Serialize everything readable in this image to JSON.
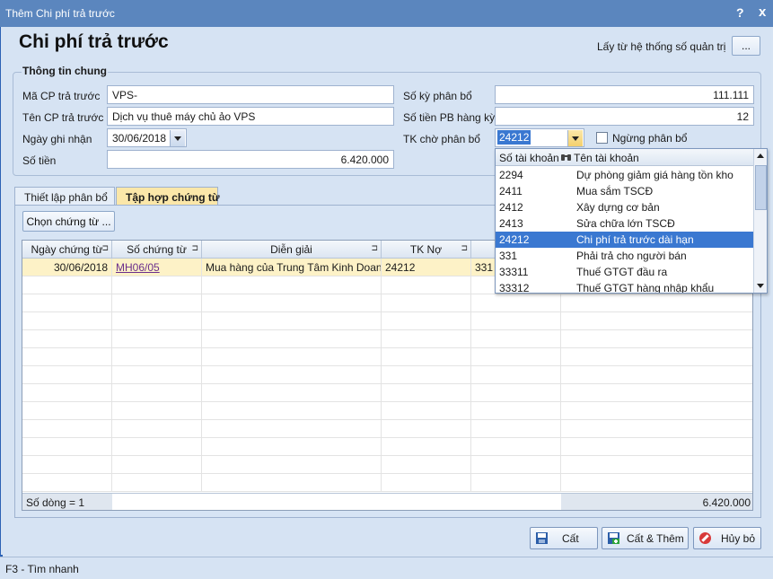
{
  "window": {
    "title": "Thêm Chi phí trả trước",
    "help_icon": "?",
    "close_icon": "x"
  },
  "heading": "Chi phí trả trước",
  "system_settings": {
    "label": "Lấy từ hệ thống số quản trị",
    "button": "..."
  },
  "general": {
    "title": "Thông tin chung",
    "ma_cp_label": "Mã CP trả trước",
    "ma_cp_value": "VPS-",
    "ten_cp_label": "Tên CP trả trước",
    "ten_cp_value": "Dịch vụ thuê máy chủ ảo VPS",
    "ngay_label": "Ngày ghi nhận",
    "ngay_value": "30/06/2018",
    "so_tien_label": "Số tiền",
    "so_tien_value": "6.420.000",
    "so_ky_label": "Số kỳ phân bổ",
    "so_ky_value": "111.111",
    "so_tien_pb_label": "Số tiền PB hàng kỳ",
    "so_tien_pb_value": "12",
    "tk_cho_label": "TK chờ phân bổ",
    "tk_cho_value": "24212",
    "ngung_label": "Ngừng phân bổ"
  },
  "tabs": [
    {
      "label": "Thiết lập phân bổ",
      "active": false
    },
    {
      "label": "Tập hợp chứng từ",
      "active": true
    }
  ],
  "choose_button": "Chọn chứng từ ...",
  "grid": {
    "columns": [
      "Ngày chứng từ",
      "Số chứng từ",
      "Diễn giải",
      "TK Nợ",
      ""
    ],
    "pin_icon": "⊐",
    "rows": [
      {
        "date": "30/06/2018",
        "no": "MH06/05",
        "desc": "Mua hàng của Trung Tâm Kinh Doan",
        "tk_no": "24212",
        "tk_co": "331"
      }
    ],
    "footer_count": "Số dòng = 1",
    "footer_total": "6.420.000"
  },
  "dropdown": {
    "col1": "Số tài khoản",
    "col2": "Tên tài khoản",
    "binoculars_icon": "binoculars-icon",
    "items": [
      {
        "code": "2294",
        "name": "Dự phòng giảm giá hàng tồn kho",
        "selected": false
      },
      {
        "code": "2411",
        "name": "Mua sắm TSCĐ",
        "selected": false
      },
      {
        "code": "2412",
        "name": "Xây dựng cơ bản",
        "selected": false
      },
      {
        "code": "2413",
        "name": "Sửa chữa lớn TSCĐ",
        "selected": false
      },
      {
        "code": "24212",
        "name": "Chi phí trả trước dài hạn",
        "selected": true
      },
      {
        "code": "331",
        "name": "Phải trả cho người bán",
        "selected": false
      },
      {
        "code": "33311",
        "name": "Thuế GTGT đầu ra",
        "selected": false
      },
      {
        "code": "33312",
        "name": "Thuế GTGT hàng nhập khẩu",
        "selected": false
      }
    ]
  },
  "actions": {
    "save": "Cất",
    "save_add": "Cất & Thêm",
    "cancel": "Hủy bỏ"
  },
  "status": "F3 - Tìm nhanh",
  "colors": {
    "titlebar": "#5b86be",
    "active_tab": "#fbe7a9",
    "selected_row": "#3a78d1"
  }
}
